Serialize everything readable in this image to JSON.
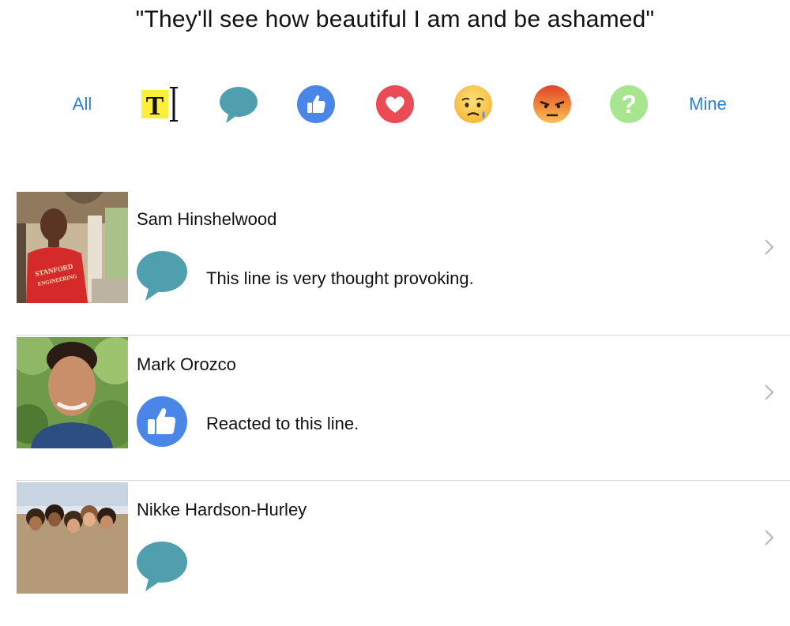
{
  "quote": "\"They'll see how beautiful I am and be ashamed\"",
  "filters": {
    "all_label": "All",
    "text_icon_glyph": "T",
    "mine_label": "Mine",
    "icons": [
      "text-cursor-icon",
      "speech-bubble-icon",
      "thumbs-up-icon",
      "heart-icon",
      "sad-face-icon",
      "angry-face-icon",
      "question-icon"
    ]
  },
  "colors": {
    "accent": "#2a7fd4",
    "comment_bubble": "#4f9fae",
    "like_blue": "#4a86e8",
    "heart_red": "#ea4b55",
    "question_green": "#a7e58f",
    "highlight_yellow": "#ffef3a"
  },
  "entries": [
    {
      "name": "Sam Hinshelwood",
      "reaction_icon": "speech-bubble-icon",
      "text": "This line is very thought provoking.",
      "shirt_text_line1": "STANFORD",
      "shirt_text_line2": "ENGINEERING"
    },
    {
      "name": "Mark Orozco",
      "reaction_icon": "thumbs-up-icon",
      "text": "Reacted to this line."
    },
    {
      "name": "Nikke Hardson-Hurley",
      "reaction_icon": "speech-bubble-icon",
      "text": ""
    }
  ]
}
